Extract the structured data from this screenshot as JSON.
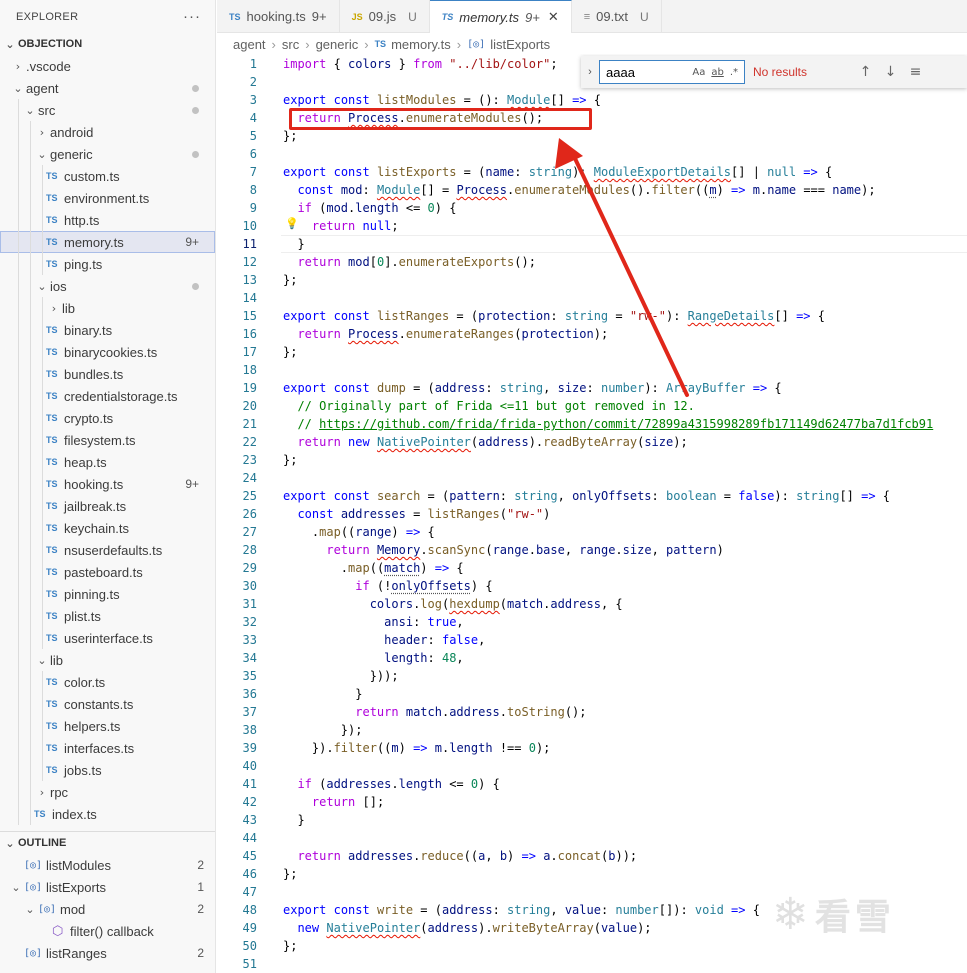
{
  "explorer": {
    "title": "EXPLORER",
    "more": "···",
    "root": "OBJECTION",
    "tree": [
      {
        "label": ".vscode",
        "kind": "folder",
        "open": false,
        "depth": 1
      },
      {
        "label": "agent",
        "kind": "folder",
        "open": true,
        "depth": 1,
        "dot": true
      },
      {
        "label": "src",
        "kind": "folder",
        "open": true,
        "depth": 2,
        "dot": true
      },
      {
        "label": "android",
        "kind": "folder",
        "open": false,
        "depth": 3
      },
      {
        "label": "generic",
        "kind": "folder",
        "open": true,
        "depth": 3,
        "dot": true
      },
      {
        "label": "custom.ts",
        "kind": "ts",
        "depth": 4
      },
      {
        "label": "environment.ts",
        "kind": "ts",
        "depth": 4
      },
      {
        "label": "http.ts",
        "kind": "ts",
        "depth": 4
      },
      {
        "label": "memory.ts",
        "kind": "ts",
        "depth": 4,
        "count": "9+",
        "selected": true
      },
      {
        "label": "ping.ts",
        "kind": "ts",
        "depth": 4
      },
      {
        "label": "ios",
        "kind": "folder",
        "open": true,
        "depth": 3,
        "dot": true
      },
      {
        "label": "lib",
        "kind": "folder",
        "open": false,
        "depth": 4
      },
      {
        "label": "binary.ts",
        "kind": "ts",
        "depth": 4
      },
      {
        "label": "binarycookies.ts",
        "kind": "ts",
        "depth": 4
      },
      {
        "label": "bundles.ts",
        "kind": "ts",
        "depth": 4
      },
      {
        "label": "credentialstorage.ts",
        "kind": "ts",
        "depth": 4
      },
      {
        "label": "crypto.ts",
        "kind": "ts",
        "depth": 4
      },
      {
        "label": "filesystem.ts",
        "kind": "ts",
        "depth": 4
      },
      {
        "label": "heap.ts",
        "kind": "ts",
        "depth": 4
      },
      {
        "label": "hooking.ts",
        "kind": "ts",
        "depth": 4,
        "count": "9+"
      },
      {
        "label": "jailbreak.ts",
        "kind": "ts",
        "depth": 4
      },
      {
        "label": "keychain.ts",
        "kind": "ts",
        "depth": 4
      },
      {
        "label": "nsuserdefaults.ts",
        "kind": "ts",
        "depth": 4
      },
      {
        "label": "pasteboard.ts",
        "kind": "ts",
        "depth": 4
      },
      {
        "label": "pinning.ts",
        "kind": "ts",
        "depth": 4
      },
      {
        "label": "plist.ts",
        "kind": "ts",
        "depth": 4
      },
      {
        "label": "userinterface.ts",
        "kind": "ts",
        "depth": 4
      },
      {
        "label": "lib",
        "kind": "folder",
        "open": true,
        "depth": 3
      },
      {
        "label": "color.ts",
        "kind": "ts",
        "depth": 4
      },
      {
        "label": "constants.ts",
        "kind": "ts",
        "depth": 4
      },
      {
        "label": "helpers.ts",
        "kind": "ts",
        "depth": 4
      },
      {
        "label": "interfaces.ts",
        "kind": "ts",
        "depth": 4
      },
      {
        "label": "jobs.ts",
        "kind": "ts",
        "depth": 4
      },
      {
        "label": "rpc",
        "kind": "folder",
        "open": false,
        "depth": 3
      },
      {
        "label": "index.ts",
        "kind": "ts",
        "depth": 3
      }
    ]
  },
  "outline": {
    "title": "OUTLINE",
    "items": [
      {
        "label": "listModules",
        "icon": "symbol-variable-icon",
        "count": "2",
        "depth": 0,
        "chev": ""
      },
      {
        "label": "listExports",
        "icon": "symbol-variable-icon",
        "count": "1",
        "depth": 0,
        "chev": "open"
      },
      {
        "label": "mod",
        "icon": "symbol-variable-icon",
        "count": "2",
        "depth": 1,
        "chev": "open"
      },
      {
        "label": "filter() callback",
        "icon": "method-cube-icon",
        "count": "",
        "depth": 2,
        "chev": ""
      },
      {
        "label": "listRanges",
        "icon": "symbol-variable-icon",
        "count": "2",
        "depth": 0,
        "chev": ""
      }
    ]
  },
  "tabs": [
    {
      "icon": "TS",
      "label": "hooking.ts",
      "badge": "9+",
      "mod": "",
      "active": false
    },
    {
      "icon": "JS",
      "label": "09.js",
      "badge": "",
      "mod": "U",
      "active": false
    },
    {
      "icon": "TS",
      "label": "memory.ts",
      "badge": "9+",
      "mod": "",
      "active": true
    },
    {
      "icon": "≡",
      "label": "09.txt",
      "badge": "",
      "mod": "U",
      "active": false
    }
  ],
  "breadcrumb": [
    "agent",
    "src",
    "generic",
    "memory.ts",
    "listExports"
  ],
  "find": {
    "value": "aaaa",
    "match_case": "Aa",
    "whole_word": "ab",
    "regex": ".*",
    "result": "No results"
  },
  "editor": {
    "active_line": 11,
    "lines": [
      {
        "n": "1",
        "html": "<span class='kc'>import</span> { <span class='v'>colors</span> } <span class='kc'>from</span> <span class='s'>\"../lib/color\"</span>;"
      },
      {
        "n": "2",
        "html": ""
      },
      {
        "n": "3",
        "html": "<span class='k'>export</span> <span class='k'>const</span> <span class='f'>listModules</span> = (): <span class='t sq'>Module</span>[] <span class='k'>=&gt;</span> {"
      },
      {
        "n": "4",
        "html": "  <span class='kc'>return</span> <span class='v sq'>Process</span>.<span class='f'>enumerateModules</span>();"
      },
      {
        "n": "5",
        "html": "};"
      },
      {
        "n": "6",
        "html": ""
      },
      {
        "n": "7",
        "html": "<span class='k'>export</span> <span class='k'>const</span> <span class='f'>listExports</span> = (<span class='v'>name</span>: <span class='t'>string</span>): <span class='t sq'>ModuleExportDetails</span>[] | <span class='t'>null</span> <span class='k'>=&gt;</span> {"
      },
      {
        "n": "8",
        "html": "  <span class='k'>const</span> <span class='v'>mod</span>: <span class='t sq'>Module</span>[] = <span class='v sq'>Process</span>.<span class='f'>enumerateModules</span>().<span class='f'>filter</span>((<span class='v dots'>m</span>) <span class='k'>=&gt;</span> <span class='v'>m</span>.<span class='v'>name</span> === <span class='v'>name</span>);"
      },
      {
        "n": "9",
        "html": "  <span class='kc'>if</span> (<span class='v'>mod</span>.<span class='v'>length</span> &lt;= <span class='n'>0</span>) {"
      },
      {
        "n": "10",
        "html": "    <span class='kc'>return</span> <span class='k'>null</span>;"
      },
      {
        "n": "11",
        "html": "  }"
      },
      {
        "n": "12",
        "html": "  <span class='kc'>return</span> <span class='v'>mod</span>[<span class='n'>0</span>].<span class='f'>enumerateExports</span>();"
      },
      {
        "n": "13",
        "html": "};"
      },
      {
        "n": "14",
        "html": ""
      },
      {
        "n": "15",
        "html": "<span class='k'>export</span> <span class='k'>const</span> <span class='f'>listRanges</span> = (<span class='v'>protection</span>: <span class='t'>string</span> = <span class='s'>\"rw-\"</span>): <span class='t sq'>RangeDetails</span>[] <span class='k'>=&gt;</span> {"
      },
      {
        "n": "16",
        "html": "  <span class='kc'>return</span> <span class='v sq'>Process</span>.<span class='f'>enumerateRanges</span>(<span class='v'>protection</span>);"
      },
      {
        "n": "17",
        "html": "};"
      },
      {
        "n": "18",
        "html": ""
      },
      {
        "n": "19",
        "html": "<span class='k'>export</span> <span class='k'>const</span> <span class='f'>dump</span> = (<span class='v'>address</span>: <span class='t'>string</span>, <span class='v'>size</span>: <span class='t'>number</span>): <span class='t'>ArrayBuffer</span> <span class='k'>=&gt;</span> {"
      },
      {
        "n": "20",
        "html": "  <span class='c'>// Originally part of Frida &lt;=11 but got removed in 12.</span>"
      },
      {
        "n": "21",
        "html": "  <span class='c'>// </span><span class='cu'>https://github.com/frida/frida-python/commit/72899a4315998289fb171149d62477ba7d1fcb91</span>"
      },
      {
        "n": "22",
        "html": "  <span class='kc'>return</span> <span class='k'>new</span> <span class='t sq'>NativePointer</span>(<span class='v'>address</span>).<span class='f'>readByteArray</span>(<span class='v'>size</span>);"
      },
      {
        "n": "23",
        "html": "};"
      },
      {
        "n": "24",
        "html": ""
      },
      {
        "n": "25",
        "html": "<span class='k'>export</span> <span class='k'>const</span> <span class='f'>search</span> = (<span class='v'>pattern</span>: <span class='t'>string</span>, <span class='v'>onlyOffsets</span>: <span class='t'>boolean</span> = <span class='k'>false</span>): <span class='t'>string</span>[] <span class='k'>=&gt;</span> {"
      },
      {
        "n": "26",
        "html": "  <span class='k'>const</span> <span class='v'>addresses</span> = <span class='f'>listRanges</span>(<span class='s'>\"rw-\"</span>)"
      },
      {
        "n": "27",
        "html": "    .<span class='f'>map</span>((<span class='v'>range</span>) <span class='k'>=&gt;</span> {"
      },
      {
        "n": "28",
        "html": "      <span class='kc'>return</span> <span class='v sq'>Memory</span>.<span class='f'>scanSync</span>(<span class='v'>range</span>.<span class='v'>base</span>, <span class='v'>range</span>.<span class='v'>size</span>, <span class='v'>pattern</span>)"
      },
      {
        "n": "29",
        "html": "        .<span class='f'>map</span>((<span class='v dots'>match</span>) <span class='k'>=&gt;</span> {"
      },
      {
        "n": "30",
        "html": "          <span class='kc'>if</span> (!<span class='v dots'>onlyOffsets</span>) {"
      },
      {
        "n": "31",
        "html": "            <span class='v'>colors</span>.<span class='f'>log</span>(<span class='f sq'>hexdump</span>(<span class='v'>match</span>.<span class='v'>address</span>, {"
      },
      {
        "n": "32",
        "html": "              <span class='v'>ansi</span>: <span class='k'>true</span>,"
      },
      {
        "n": "33",
        "html": "              <span class='v'>header</span>: <span class='k'>false</span>,"
      },
      {
        "n": "34",
        "html": "              <span class='v'>length</span>: <span class='n'>48</span>,"
      },
      {
        "n": "35",
        "html": "            }));"
      },
      {
        "n": "36",
        "html": "          }"
      },
      {
        "n": "37",
        "html": "          <span class='kc'>return</span> <span class='v'>match</span>.<span class='v'>address</span>.<span class='f'>toString</span>();"
      },
      {
        "n": "38",
        "html": "        });"
      },
      {
        "n": "39",
        "html": "    }).<span class='f'>filter</span>((<span class='v'>m</span>) <span class='k'>=&gt;</span> <span class='v'>m</span>.<span class='v'>length</span> !== <span class='n'>0</span>);"
      },
      {
        "n": "40",
        "html": ""
      },
      {
        "n": "41",
        "html": "  <span class='kc'>if</span> (<span class='v'>addresses</span>.<span class='v'>length</span> &lt;= <span class='n'>0</span>) {"
      },
      {
        "n": "42",
        "html": "    <span class='kc'>return</span> [];"
      },
      {
        "n": "43",
        "html": "  }"
      },
      {
        "n": "44",
        "html": ""
      },
      {
        "n": "45",
        "html": "  <span class='kc'>return</span> <span class='v'>addresses</span>.<span class='f'>reduce</span>((<span class='v'>a</span>, <span class='v'>b</span>) <span class='k'>=&gt;</span> <span class='v'>a</span>.<span class='f'>concat</span>(<span class='v'>b</span>));"
      },
      {
        "n": "46",
        "html": "};"
      },
      {
        "n": "47",
        "html": ""
      },
      {
        "n": "48",
        "html": "<span class='k'>export</span> <span class='k'>const</span> <span class='f'>write</span> = (<span class='v'>address</span>: <span class='t'>string</span>, <span class='v'>value</span>: <span class='t'>number</span>[]): <span class='t'>void</span> <span class='k'>=&gt;</span> {"
      },
      {
        "n": "49",
        "html": "  <span class='k'>new</span> <span class='t sq'>NativePointer</span>(<span class='v'>address</span>).<span class='f'>writeByteArray</span>(<span class='v'>value</span>);"
      },
      {
        "n": "50",
        "html": "};"
      },
      {
        "n": "51",
        "html": ""
      }
    ]
  },
  "watermark": "看雪",
  "colors": {
    "annotation": "#e0271a",
    "accent": "#3c82c4"
  }
}
